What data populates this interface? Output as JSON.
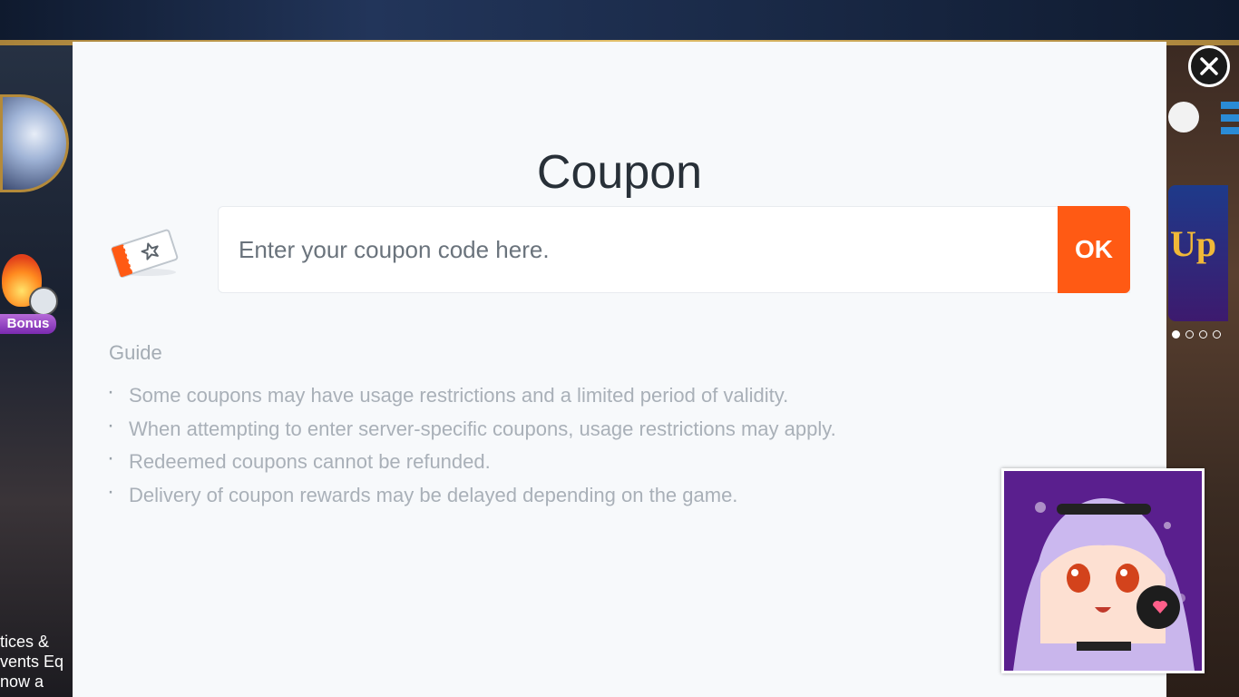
{
  "background": {
    "bonus_label": "Bonus",
    "side_text": [
      "tices &",
      "vents Eq",
      "now a"
    ],
    "banner_text": "Up"
  },
  "modal": {
    "title": "Coupon",
    "input_placeholder": "Enter your coupon code here.",
    "input_value": "",
    "ok_label": "OK",
    "guide_title": "Guide",
    "guide_items": [
      "Some coupons may have usage restrictions and a limited period of validity.",
      "When attempting to enter server-specific coupons, usage restrictions may apply.",
      "Redeemed coupons cannot be refunded.",
      "Delivery of coupon rewards may be delayed depending on the game."
    ]
  },
  "colors": {
    "accent": "#ff5a14",
    "modal_bg": "#f7f9fb",
    "title": "#283038",
    "guide_text": "#a9b0b8"
  },
  "icons": {
    "coupon": "coupon-ticket-icon",
    "close": "close-icon"
  }
}
